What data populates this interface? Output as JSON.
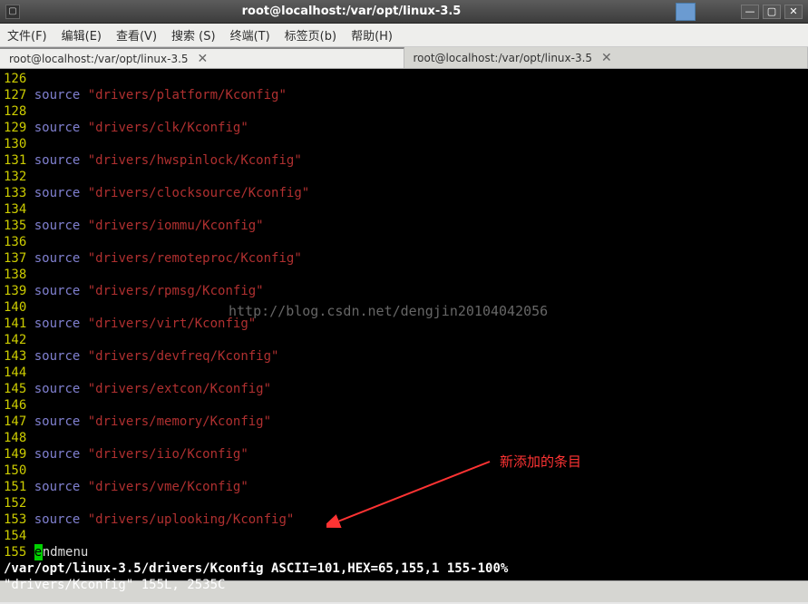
{
  "window": {
    "title": "root@localhost:/var/opt/linux-3.5"
  },
  "menubar": {
    "file": "文件(F)",
    "edit": "编辑(E)",
    "view": "查看(V)",
    "search": "搜索 (S)",
    "terminal": "终端(T)",
    "tabs": "标签页(b)",
    "help": "帮助(H)"
  },
  "tabs": {
    "tab1": "root@localhost:/var/opt/linux-3.5",
    "tab2": "root@localhost:/var/opt/linux-3.5"
  },
  "editor": {
    "keyword": "source",
    "lines": [
      {
        "n": "126",
        "path": ""
      },
      {
        "n": "127",
        "path": "\"drivers/platform/Kconfig\""
      },
      {
        "n": "128",
        "path": ""
      },
      {
        "n": "129",
        "path": "\"drivers/clk/Kconfig\""
      },
      {
        "n": "130",
        "path": ""
      },
      {
        "n": "131",
        "path": "\"drivers/hwspinlock/Kconfig\""
      },
      {
        "n": "132",
        "path": ""
      },
      {
        "n": "133",
        "path": "\"drivers/clocksource/Kconfig\""
      },
      {
        "n": "134",
        "path": ""
      },
      {
        "n": "135",
        "path": "\"drivers/iommu/Kconfig\""
      },
      {
        "n": "136",
        "path": ""
      },
      {
        "n": "137",
        "path": "\"drivers/remoteproc/Kconfig\""
      },
      {
        "n": "138",
        "path": ""
      },
      {
        "n": "139",
        "path": "\"drivers/rpmsg/Kconfig\""
      },
      {
        "n": "140",
        "path": ""
      },
      {
        "n": "141",
        "path": "\"drivers/virt/Kconfig\""
      },
      {
        "n": "142",
        "path": ""
      },
      {
        "n": "143",
        "path": "\"drivers/devfreq/Kconfig\""
      },
      {
        "n": "144",
        "path": ""
      },
      {
        "n": "145",
        "path": "\"drivers/extcon/Kconfig\""
      },
      {
        "n": "146",
        "path": ""
      },
      {
        "n": "147",
        "path": "\"drivers/memory/Kconfig\""
      },
      {
        "n": "148",
        "path": ""
      },
      {
        "n": "149",
        "path": "\"drivers/iio/Kconfig\""
      },
      {
        "n": "150",
        "path": ""
      },
      {
        "n": "151",
        "path": "\"drivers/vme/Kconfig\""
      },
      {
        "n": "152",
        "path": ""
      },
      {
        "n": "153",
        "path": "\"drivers/uplooking/Kconfig\""
      },
      {
        "n": "154",
        "path": ""
      }
    ],
    "last_line_num": "155",
    "endmenu_first": "e",
    "endmenu_rest": "ndmenu",
    "status": "/var/opt/linux-3.5/drivers/Kconfig ASCII=101,HEX=65,155,1 155-100%",
    "info": "\"drivers/Kconfig\" 155L, 2535C"
  },
  "annotation": {
    "text": "新添加的条目"
  },
  "watermark": "http://blog.csdn.net/dengjin20104042056"
}
